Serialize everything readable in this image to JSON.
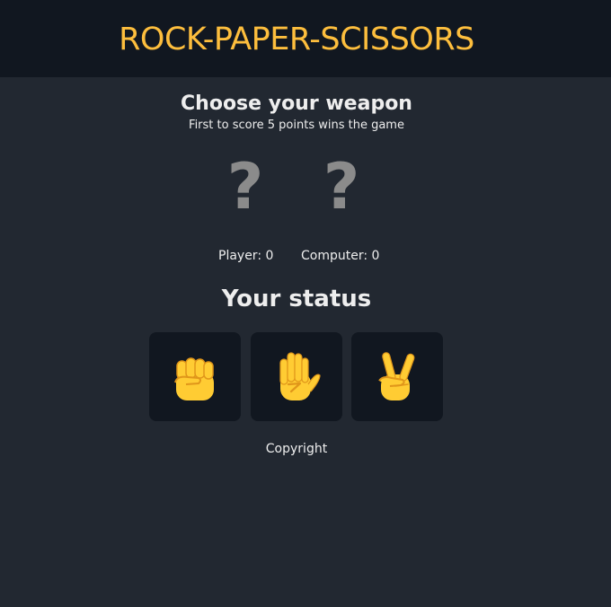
{
  "header": {
    "title": "ROCK-PAPER-SCISSORS"
  },
  "intro": {
    "heading": "Choose your weapon",
    "subheading": "First to score 5 points wins the game"
  },
  "choices": {
    "player": "?",
    "computer": "?"
  },
  "scoreboard": {
    "player_label": "Player:",
    "player_score": "0",
    "computer_label": "Computer:",
    "computer_score": "0"
  },
  "status": {
    "text": "Your status"
  },
  "weapons": [
    {
      "name": "rock",
      "icon": "fist-icon"
    },
    {
      "name": "paper",
      "icon": "raised-hand-icon"
    },
    {
      "name": "scissors",
      "icon": "victory-hand-icon"
    }
  ],
  "colors": {
    "background": "#222831",
    "header_background": "#111720",
    "title": "#fdbe3d",
    "text": "#eeeeee",
    "question_mark": "#8b8b8b",
    "button_background": "#111720",
    "emoji_yellow": "#ffcc33",
    "emoji_shadow": "#e0961a"
  },
  "footer": {
    "text": "Copyright"
  }
}
